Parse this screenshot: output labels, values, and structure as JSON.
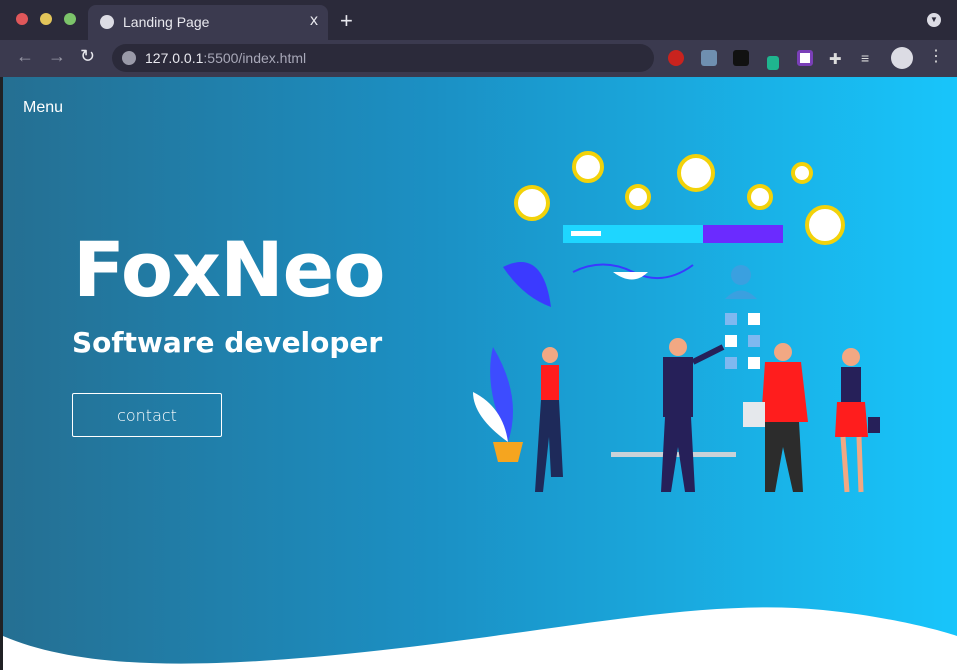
{
  "browser": {
    "tab_title": "Landing Page",
    "url_host": "127.0.0.1",
    "url_rest": ":5500/index.html",
    "new_tab": "+",
    "close": "x"
  },
  "page": {
    "menu": "Menu",
    "title": "FoxNeo",
    "subtitle": "Software developer",
    "contact_label": "contact"
  },
  "colors": {
    "gradient_start": "#256f92",
    "gradient_end": "#18c5fb"
  }
}
